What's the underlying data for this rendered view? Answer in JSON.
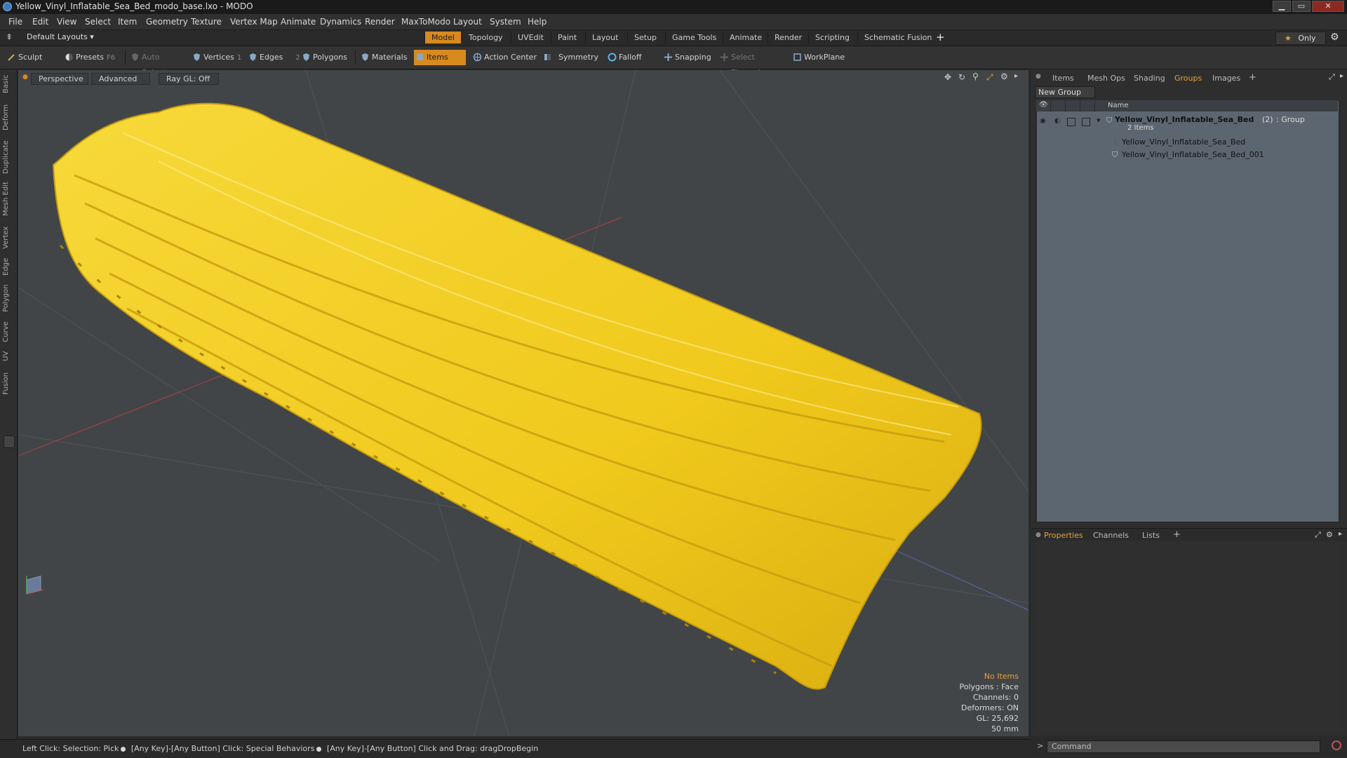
{
  "window": {
    "title": "Yellow_Vinyl_Inflatable_Sea_Bed_modo_base.lxo - MODO",
    "min": "▁",
    "max": "▭",
    "close": "✕"
  },
  "menu": [
    "File",
    "Edit",
    "View",
    "Select",
    "Item",
    "Geometry",
    "Texture",
    "Vertex Map",
    "Animate",
    "Dynamics",
    "Render",
    "MaxToModo",
    "Layout",
    "System",
    "Help"
  ],
  "layouts": {
    "selector": "Default Layouts ▾",
    "tabs": [
      "Model",
      "Topology",
      "UVEdit",
      "Paint",
      "Layout",
      "Setup",
      "Game Tools",
      "Animate",
      "Render",
      "Scripting",
      "Schematic Fusion"
    ],
    "active": "Model",
    "add": "+",
    "only": "Only",
    "star": "★"
  },
  "toolbar": {
    "sculpt": "Sculpt",
    "presets": "Presets",
    "presets_key": "F6",
    "auto_select": "Auto Select",
    "vertices": "Vertices",
    "vertices_key": "1",
    "edges": "Edges",
    "edges_key": "2",
    "polygons": "Polygons",
    "materials": "Materials",
    "items": "Items",
    "action_center": "Action Center",
    "symmetry": "Symmetry",
    "falloff": "Falloff",
    "snapping": "Snapping",
    "select_through": "Select Through",
    "workplane": "WorkPlane"
  },
  "left_tabs": [
    "Basic",
    "Deform",
    "Duplicate",
    "Mesh Edit",
    "Vertex",
    "Edge",
    "Polygon",
    "Curve",
    "UV",
    "Fusion"
  ],
  "viewport": {
    "perspective": "Perspective",
    "advanced": "Advanced",
    "raygl": "Ray GL: Off",
    "info": {
      "no_items": "No Items",
      "polygons": "Polygons : Face",
      "channels": "Channels: 0",
      "deformers": "Deformers: ON",
      "gl": "GL: 25,692",
      "scale": "50 mm"
    }
  },
  "status": {
    "a": "Left Click: Selection: Pick",
    "b": "[Any Key]-[Any Button] Click: Special Behaviors",
    "c": "[Any Key]-[Any Button] Click and Drag: dragDropBegin"
  },
  "panel_top": {
    "tabs": [
      "Items",
      "Mesh Ops",
      "Shading",
      "Groups",
      "Images"
    ],
    "active": "Groups",
    "add": "+",
    "new_group": "New Group",
    "col_name": "Name",
    "group_name": "Yellow_Vinyl_Inflatable_Sea_Bed",
    "group_count": "(2)",
    "group_type": ": Group",
    "group_sub": "2 Items",
    "children": [
      "Yellow_Vinyl_Inflatable_Sea_Bed",
      "Yellow_Vinyl_Inflatable_Sea_Bed_001"
    ]
  },
  "panel_bottom": {
    "tabs": [
      "Properties",
      "Channels",
      "Lists"
    ],
    "active": "Properties",
    "add": "+"
  },
  "command": {
    "prompt": ">",
    "placeholder": "Command"
  },
  "colors": {
    "accent": "#d78a1e",
    "yellow": "#f2cf1f",
    "viewport": "#414548"
  }
}
